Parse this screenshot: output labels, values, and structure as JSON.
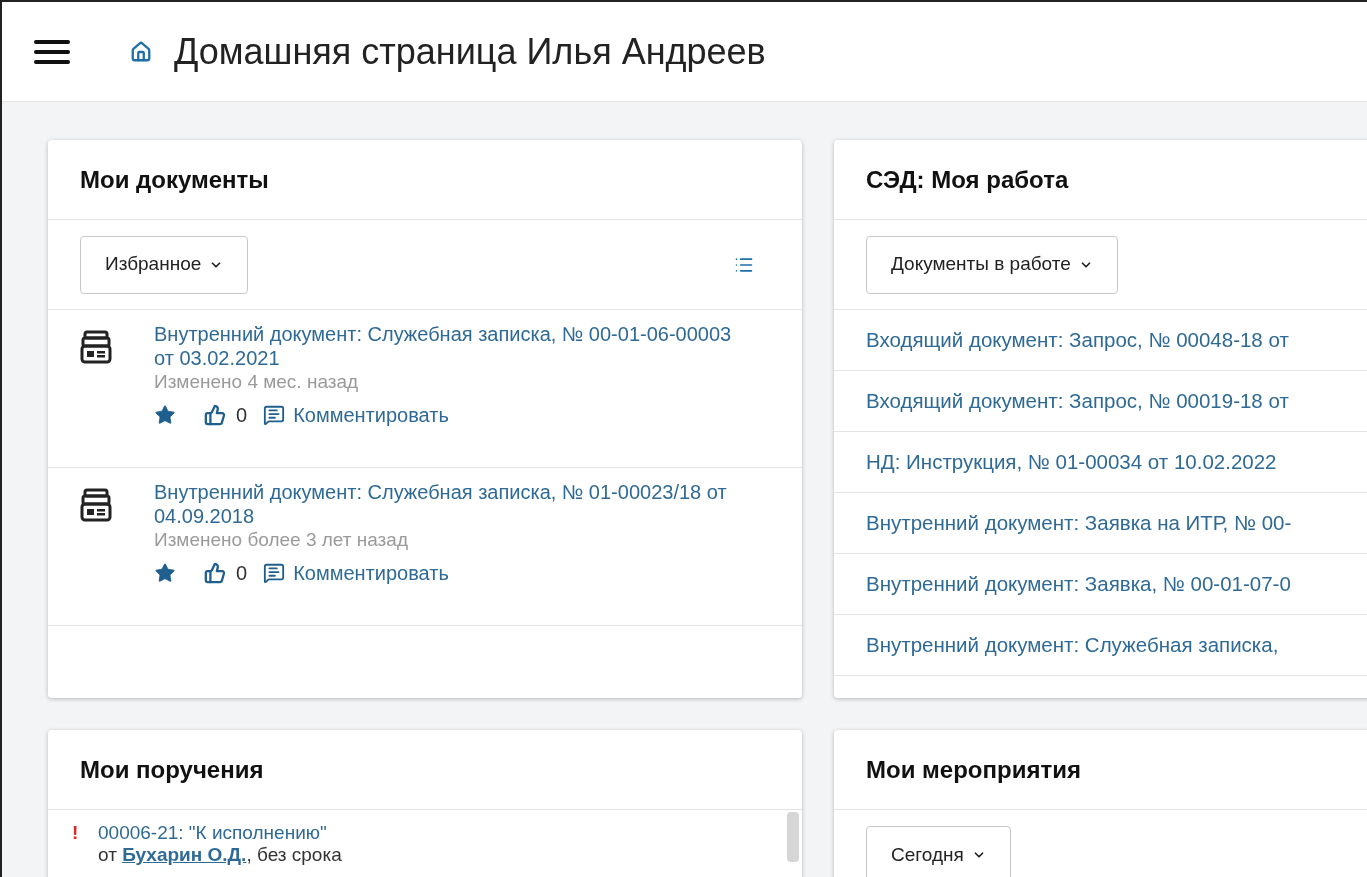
{
  "header": {
    "title": "Домашняя страница Илья Андреев"
  },
  "my_documents": {
    "title": "Мои документы",
    "filter": "Избранное",
    "items": [
      {
        "title": "Внутренний документ: Служебная записка, № 00-01-06-00003 от 03.02.2021",
        "modified": "Изменено 4 мес. назад",
        "starred": true,
        "likes": "0",
        "comment": "Комментировать"
      },
      {
        "title": "Внутренний документ: Служебная записка, № 01-00023/18 от 04.09.2018",
        "modified": "Изменено более 3 лет назад",
        "starred": true,
        "likes": "0",
        "comment": "Комментировать"
      }
    ]
  },
  "my_work": {
    "title": "СЭД: Моя работа",
    "filter": "Документы в работе",
    "items": [
      "Входящий документ: Запрос, № 00048-18 от",
      "Входящий документ: Запрос, № 00019-18 от",
      "НД: Инструкция, № 01-00034 от 10.02.2022",
      "Внутренний документ: Заявка на ИТР, № 00-",
      "Внутренний документ: Заявка, № 00-01-07-0",
      "Внутренний документ: Служебная записка,"
    ]
  },
  "my_tasks": {
    "title": "Мои поручения",
    "items": [
      {
        "urgent": true,
        "flag": "!",
        "title": "00006-21: \"К исполнению\"",
        "from": "от",
        "author": "Бухарин О.Д.",
        "due": ", без срока"
      }
    ]
  },
  "my_events": {
    "title": "Мои мероприятия",
    "filter": "Сегодня"
  }
}
